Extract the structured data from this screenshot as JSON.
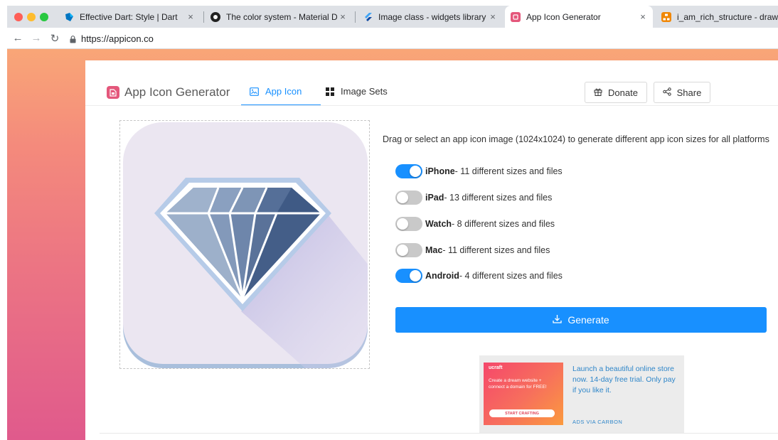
{
  "browser": {
    "tabs": [
      {
        "title": "Effective Dart: Style | Dart",
        "favicon": "dart-icon",
        "active": false
      },
      {
        "title": "The color system - Material De",
        "favicon": "github-icon",
        "active": false
      },
      {
        "title": "Image class - widgets library -",
        "favicon": "flutter-icon",
        "active": false
      },
      {
        "title": "App Icon Generator",
        "favicon": "appicon-icon",
        "active": true
      },
      {
        "title": "i_am_rich_structure - draw.io",
        "favicon": "drawio-icon",
        "active": false
      }
    ],
    "close_glyph": "×",
    "url": "https://appicon.co"
  },
  "app": {
    "logo_text": "App Icon Generator",
    "nav": {
      "app_icon": "App Icon",
      "image_sets": "Image Sets"
    },
    "donate_label": "Donate",
    "share_label": "Share",
    "description": "Drag or select an app icon image (1024x1024) to generate different app icon sizes for all platforms",
    "options": [
      {
        "name": "iPhone",
        "detail": " - 11 different sizes and files",
        "enabled": true
      },
      {
        "name": "iPad",
        "detail": " - 13 different sizes and files",
        "enabled": false
      },
      {
        "name": "Watch",
        "detail": " - 8 different sizes and files",
        "enabled": false
      },
      {
        "name": "Mac",
        "detail": " - 11 different sizes and files",
        "enabled": false
      },
      {
        "name": "Android",
        "detail": " - 4 different sizes and files",
        "enabled": true
      }
    ],
    "generate_label": "Generate"
  },
  "ad": {
    "brand": "ucraft",
    "image_message": "Create a dream website + connect a domain for FREE!",
    "image_cta": "START CRAFTING",
    "text": "Launch a beautiful online store now. 14-day free trial. Only pay if you like it.",
    "via": "ADS VIA CARBON"
  },
  "colors": {
    "accent": "#1890ff",
    "toggle_off": "#c9c9c9",
    "logo_pink": "#e4577b"
  }
}
